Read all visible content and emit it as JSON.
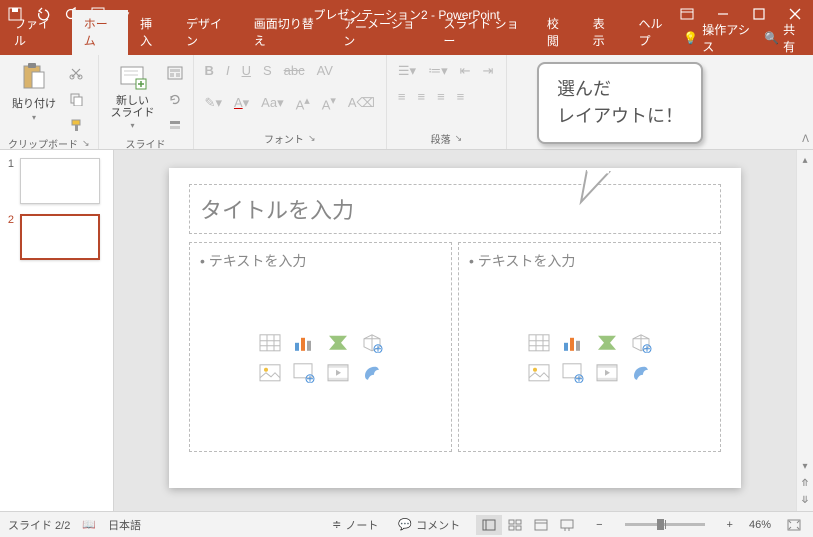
{
  "titlebar": {
    "document_title": "プレゼンテーション2 - PowerPoint"
  },
  "tabs": {
    "file": "ファイル",
    "home": "ホーム",
    "insert": "挿入",
    "design": "デザイン",
    "transitions": "画面切り替え",
    "animations": "アニメーション",
    "slideshow": "スライド ショー",
    "review": "校閲",
    "view": "表示",
    "help": "ヘルプ",
    "tell_me": "操作アシス",
    "share": "共有"
  },
  "ribbon": {
    "clipboard": {
      "label": "クリップボード",
      "paste": "貼り付け"
    },
    "slides": {
      "label": "スライド",
      "new_slide": "新しい\nスライド"
    },
    "font": {
      "label": "フォント"
    },
    "paragraph": {
      "label": "段落"
    }
  },
  "callout": {
    "line1": "選んだ",
    "line2": "レイアウトに！"
  },
  "thumbnails": [
    {
      "num": "1",
      "active": false
    },
    {
      "num": "2",
      "active": true
    }
  ],
  "slide": {
    "title_placeholder": "タイトルを入力",
    "content_placeholder": "テキストを入力"
  },
  "statusbar": {
    "slide_indicator": "スライド 2/2",
    "language": "日本語",
    "notes": "ノート",
    "comments": "コメント",
    "zoom_pct": "46%"
  }
}
